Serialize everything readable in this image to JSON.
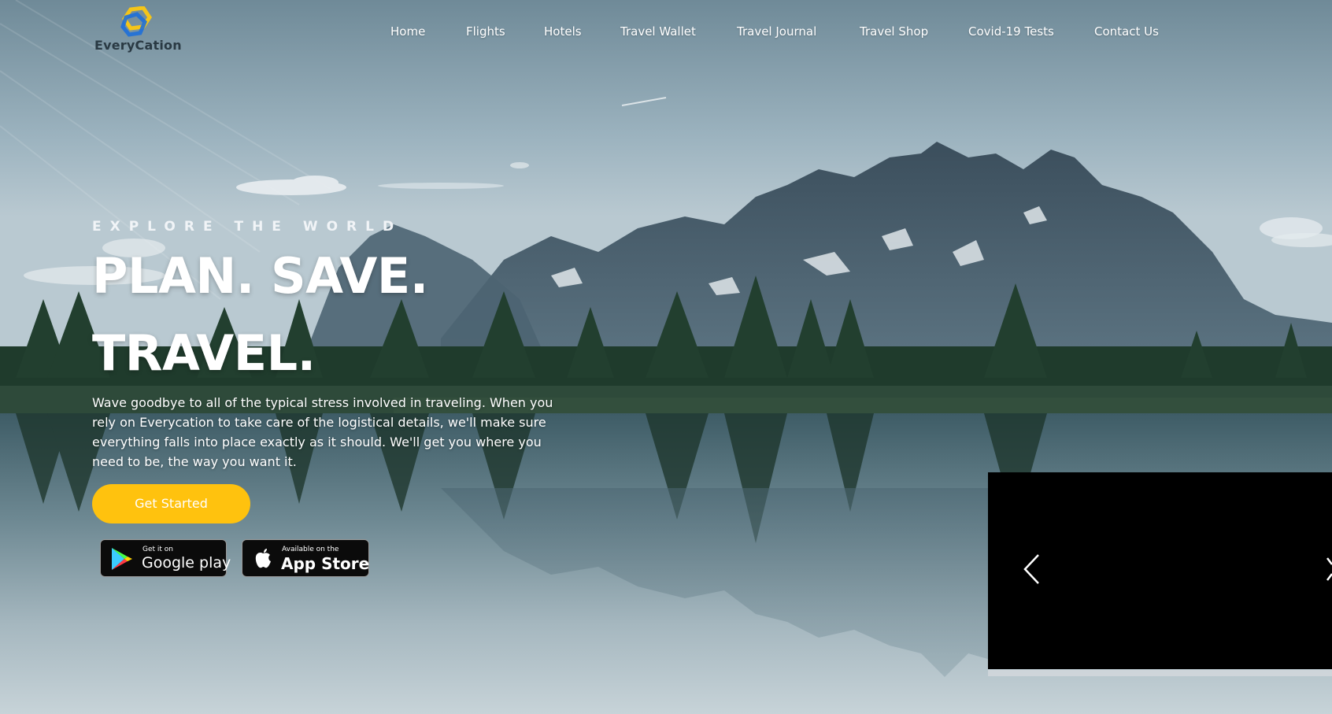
{
  "brand": {
    "name": "EveryCation",
    "colors": {
      "accent": "#ffc20e",
      "logo_blue": "#1e6fd9",
      "logo_yellow": "#f5c518",
      "text_dark": "#2a3a44"
    }
  },
  "nav": {
    "items": [
      {
        "label": "Home"
      },
      {
        "label": "Flights"
      },
      {
        "label": "Hotels"
      },
      {
        "label": "Travel Wallet"
      },
      {
        "label": "Travel Journal"
      },
      {
        "label": "Travel Shop"
      },
      {
        "label": "Covid-19 Tests"
      },
      {
        "label": "Contact Us"
      }
    ]
  },
  "hero": {
    "eyebrow": "EXPLORE THE WORLD",
    "headline_line1": "PLAN. SAVE.",
    "headline_line2": "TRAVEL.",
    "description": "Wave goodbye to all of the typical stress involved in traveling. When you rely on Everycation to take care of the logistical details, we'll make sure everything falls into place exactly as it should. We'll get you where you need to be, the way you want it.",
    "cta_label": "Get Started"
  },
  "store_badges": {
    "google": {
      "small": "Get it on",
      "big": "Google play",
      "icon": "google-play-icon"
    },
    "apple": {
      "small": "Available on the",
      "big": "App Store",
      "icon": "apple-icon"
    }
  },
  "slider": {
    "prev_icon": "chevron-left-icon",
    "next_icon": "chevron-right-icon"
  }
}
